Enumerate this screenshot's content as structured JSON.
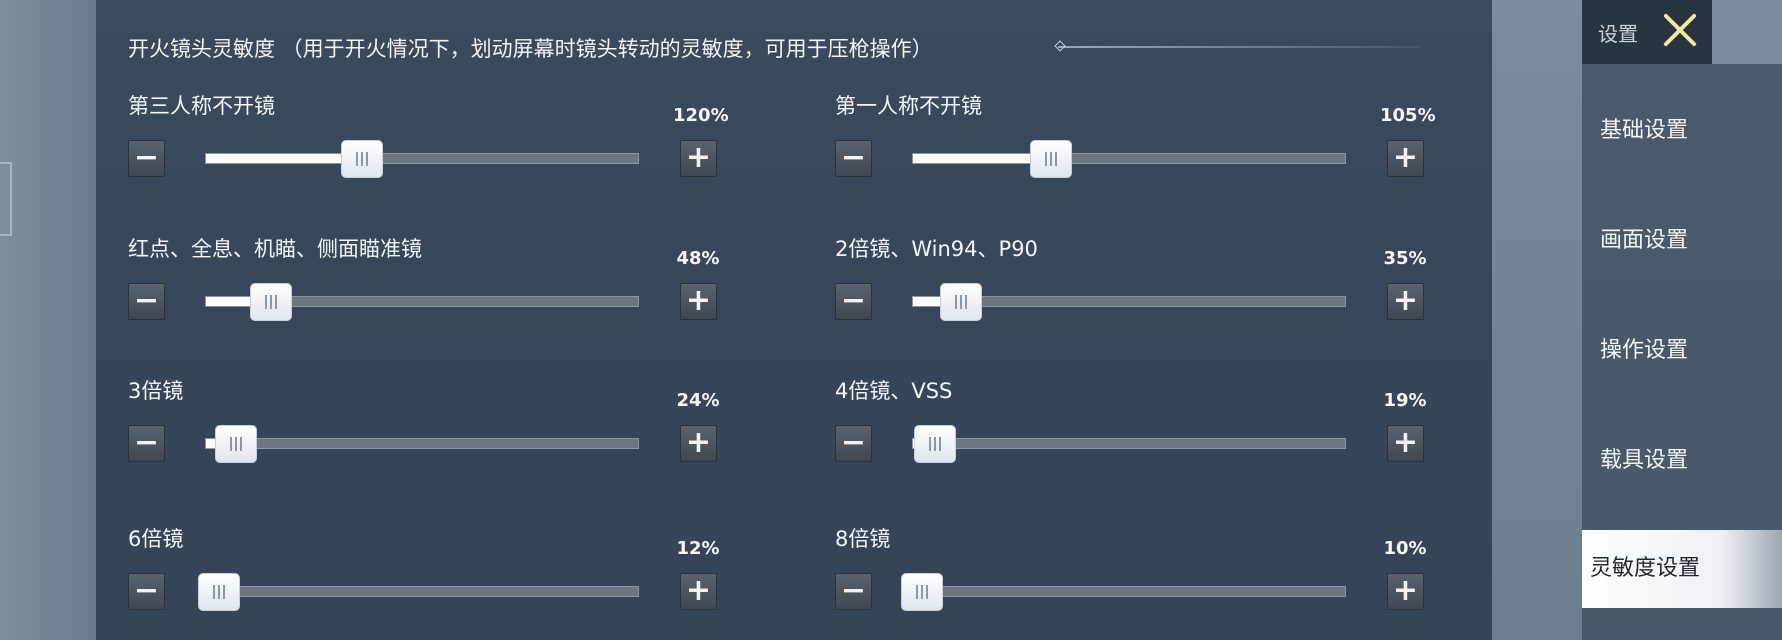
{
  "section": {
    "title": "开火镜头灵敏度 （用于开火情况下，划动屏幕时镜头转动的灵敏度，可用于压枪操作）"
  },
  "sliders": [
    {
      "label": "第三人称不开镜",
      "value_text": "120%",
      "fill_fraction": 0.36
    },
    {
      "label": "第一人称不开镜",
      "value_text": "105%",
      "fill_fraction": 0.32
    },
    {
      "label": "红点、全息、机瞄、侧面瞄准镜",
      "value_text": "48%",
      "fill_fraction": 0.15
    },
    {
      "label": "2倍镜、Win94、P90",
      "value_text": "35%",
      "fill_fraction": 0.11
    },
    {
      "label": "3倍镜",
      "value_text": "24%",
      "fill_fraction": 0.07
    },
    {
      "label": "4倍镜、VSS",
      "value_text": "19%",
      "fill_fraction": 0.05
    },
    {
      "label": "6倍镜",
      "value_text": "12%",
      "fill_fraction": 0.03
    },
    {
      "label": "8倍镜",
      "value_text": "10%",
      "fill_fraction": 0.02
    }
  ],
  "buttons": {
    "minus": "−",
    "plus": "+"
  },
  "menu": {
    "header": "设置",
    "items": [
      {
        "label": "基础设置",
        "active": false
      },
      {
        "label": "画面设置",
        "active": false
      },
      {
        "label": "操作设置",
        "active": false
      },
      {
        "label": "载具设置",
        "active": false
      },
      {
        "label": "灵敏度设置",
        "active": true
      }
    ]
  },
  "colors": {
    "accent_close": "#f4e9a0",
    "track_fill": "#ffffff",
    "panel": "#303e50"
  }
}
